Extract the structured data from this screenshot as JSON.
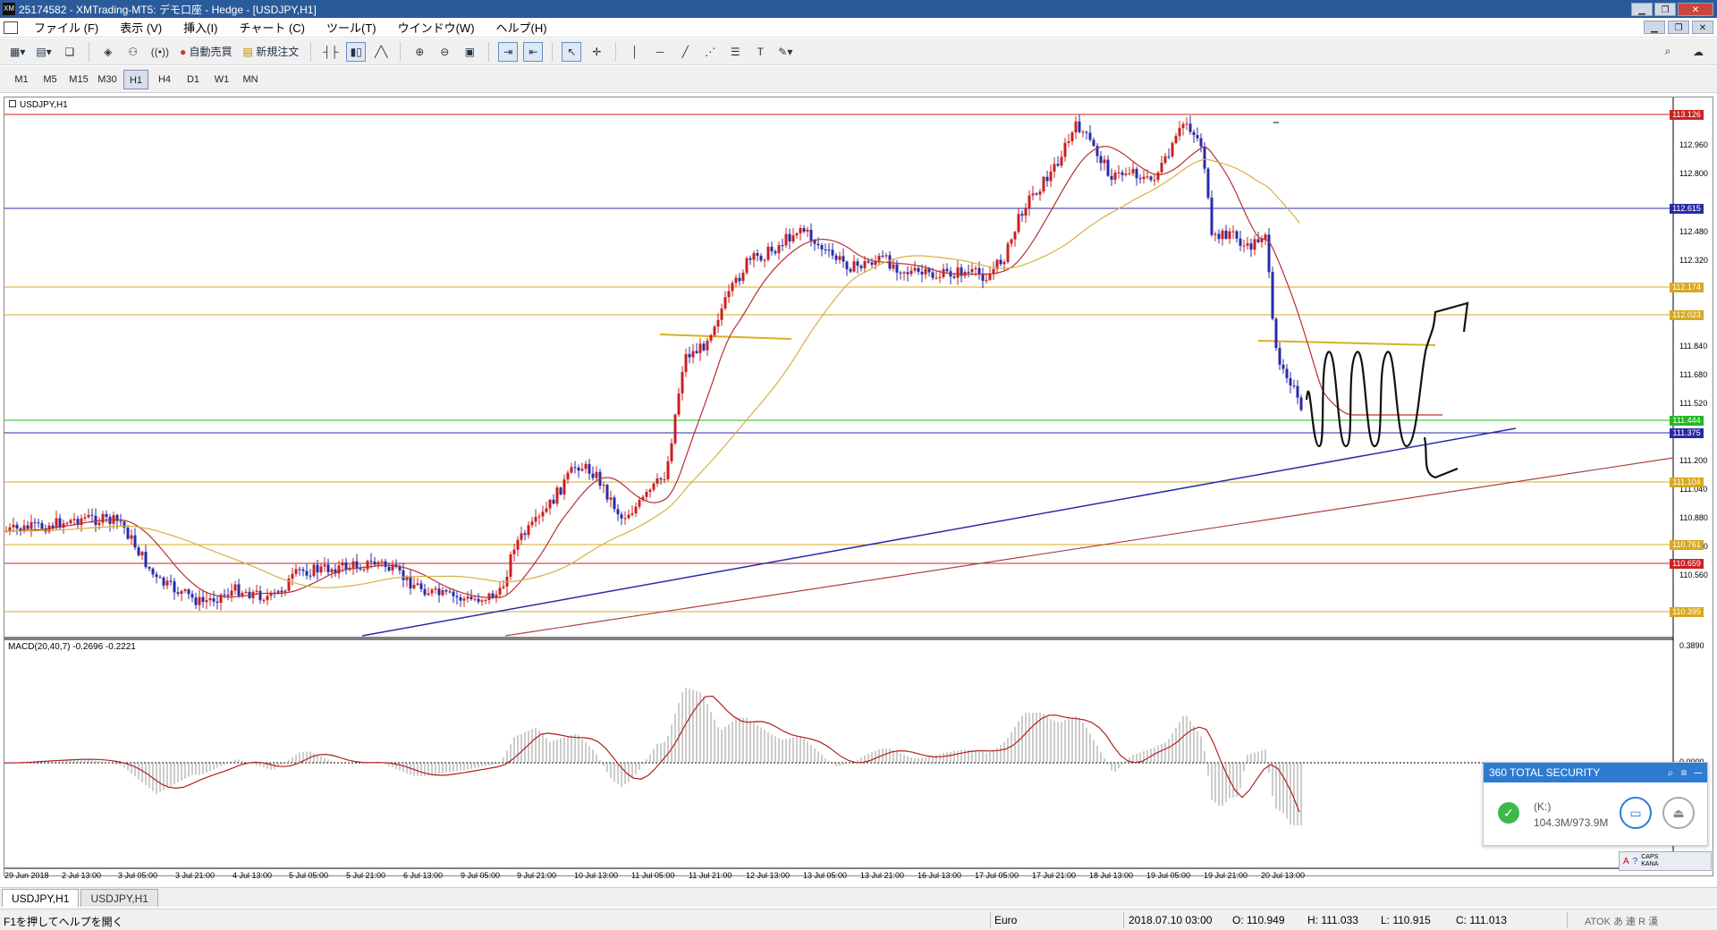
{
  "window": {
    "title": "25174582 - XMTrading-MT5: デモ口座 - Hedge - [USDJPY,H1]",
    "app_icon": "XM"
  },
  "menu": [
    "ファイル (F)",
    "表示 (V)",
    "挿入(I)",
    "チャート (C)",
    "ツール(T)",
    "ウインドウ(W)",
    "ヘルプ(H)"
  ],
  "toolbar": {
    "auto_trade_label": "自動売買",
    "new_order_label": "新規注文",
    "icons": [
      "new-chart-icon",
      "profiles-icon",
      "templates-icon",
      "market-watch-icon",
      "navigator-icon",
      "signals-icon",
      "auto-trade-icon",
      "new-order-icon",
      "bar-chart-icon",
      "candle-chart-icon",
      "line-chart-icon",
      "zoom-in-icon",
      "zoom-out-icon",
      "tile-icon",
      "autoscroll-icon",
      "chart-shift-icon",
      "cursor-icon",
      "crosshair-icon",
      "vertical-line-icon",
      "horizontal-line-icon",
      "trendline-icon",
      "fibo-icon",
      "channel-icon",
      "text-icon",
      "objects-icon"
    ]
  },
  "timeframes": [
    "M1",
    "M5",
    "M15",
    "M30",
    "H1",
    "H4",
    "D1",
    "W1",
    "MN"
  ],
  "active_timeframe": "H1",
  "chart": {
    "symbol_label": "USDJPY,H1",
    "macd_label": "MACD(20,40,7) -0.2696 -0.2221",
    "price_labels": [
      "112.960",
      "112.800",
      "112.480",
      "112.320",
      "111.840",
      "111.680",
      "111.520",
      "111.200",
      "111.040",
      "110.880",
      "110.720",
      "110.560"
    ],
    "macd_labels": [
      "0.3890",
      "0.0000"
    ],
    "level_tags": [
      {
        "text": "113.126",
        "color": "#cc2222"
      },
      {
        "text": "112.615",
        "color": "#2a2aa8"
      },
      {
        "text": "112.174",
        "color": "#d8a820"
      },
      {
        "text": "112.023",
        "color": "#d8a820"
      },
      {
        "text": "111.444",
        "color": "#22b822"
      },
      {
        "text": "111.375",
        "color": "#2a2aa8"
      },
      {
        "text": "111.104",
        "color": "#d8a820"
      },
      {
        "text": "110.761",
        "color": "#d8a820"
      },
      {
        "text": "110.659",
        "color": "#cc2222"
      },
      {
        "text": "110.395",
        "color": "#d8a820"
      }
    ],
    "date_labels": [
      "29 Jun 2018",
      "2 Jul 13:00",
      "3 Jul 05:00",
      "3 Jul 21:00",
      "4 Jul 13:00",
      "5 Jul 05:00",
      "5 Jul 21:00",
      "6 Jul 13:00",
      "9 Jul 05:00",
      "9 Jul 21:00",
      "10 Jul 13:00",
      "11 Jul 05:00",
      "11 Jul 21:00",
      "12 Jul 13:00",
      "13 Jul 05:00",
      "13 Jul 21:00",
      "16 Jul 13:00",
      "17 Jul 05:00",
      "17 Jul 21:00",
      "18 Jul 13:00",
      "19 Jul 05:00",
      "19 Jul 21:00",
      "20 Jul 13:00"
    ]
  },
  "tabs": [
    "USDJPY,H1",
    "USDJPY,H1"
  ],
  "status": {
    "help": "F1を押してヘルプを開く",
    "profile": "Euro",
    "datetime": "2018.07.10 03:00",
    "open": "O: 110.949",
    "high": "H: 111.033",
    "low": "L: 110.915",
    "close": "C: 111.013",
    "ime": "ATOK あ 連 R 漢"
  },
  "security_popup": {
    "title": "360 TOTAL SECURITY",
    "drive": "(K:)",
    "size": "104.3M/973.9M"
  },
  "tray": {
    "caps": "CAPS",
    "kana": "KANA"
  }
}
